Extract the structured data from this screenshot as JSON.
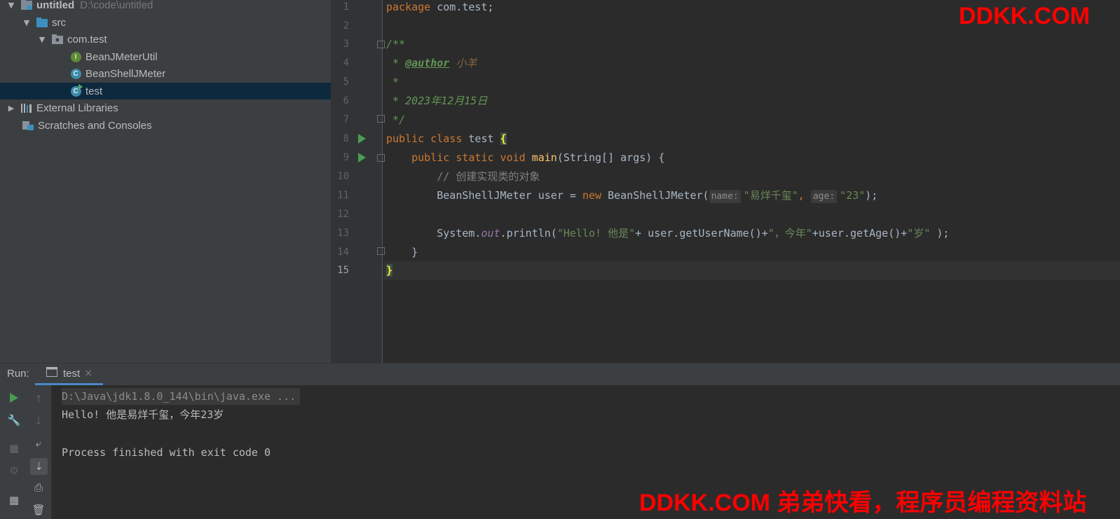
{
  "project_tree": {
    "root_name": "untitled",
    "root_path": "D:\\code\\untitled",
    "items": [
      {
        "label": "src"
      },
      {
        "label": "com.test"
      },
      {
        "label": "BeanJMeterUtil",
        "badge": "I"
      },
      {
        "label": "BeanShellJMeter",
        "badge": "C"
      },
      {
        "label": "test",
        "badge": "C"
      },
      {
        "label": "External Libraries"
      },
      {
        "label": "Scratches and Consoles"
      }
    ]
  },
  "editor": {
    "line_numbers": [
      "1",
      "2",
      "3",
      "4",
      "5",
      "6",
      "7",
      "8",
      "9",
      "10",
      "11",
      "12",
      "13",
      "14",
      "15"
    ],
    "current_line": "15",
    "code": {
      "l1_kw": "package",
      "l1_rest": " com.test;",
      "l3": "/**",
      "l4_star": " * ",
      "l4_tag": "@author",
      "l4_val": " 小羊",
      "l5": " *",
      "l6": " * 2023年12月15日",
      "l7": " */",
      "l8_kw": "public class",
      "l8_name": " test ",
      "l8_brace": "{",
      "l9_indent": "    ",
      "l9_kw": "public static void",
      "l9_fn": " main",
      "l9_rest": "(String[] args) {",
      "l10": "        // 创建实现类的对象",
      "l11_indent": "        ",
      "l11_a": "BeanShellJMeter user = ",
      "l11_kw": "new",
      "l11_b": " BeanShellJMeter(",
      "l11_hint1": "name:",
      "l11_s1": "\"易烊千玺\"",
      "l11_c": ", ",
      "l11_hint2": "age:",
      "l11_s2": "\"23\"",
      "l11_d": ");",
      "l13_indent": "        ",
      "l13_a": "System.",
      "l13_out": "out",
      "l13_b": ".println(",
      "l13_s1": "\"Hello! 他是\"",
      "l13_c": "+ user.getUserName()+",
      "l13_s2": "\"，今年\"",
      "l13_d": "+user.getAge()+",
      "l13_s3": "\"岁\"",
      "l13_e": " );",
      "l14": "    }",
      "l15": "}"
    }
  },
  "run_panel": {
    "label": "Run:",
    "tab": "test",
    "tab_close": "×",
    "console": {
      "cmd": "D:\\Java\\jdk1.8.0_144\\bin\\java.exe ...",
      "output": "Hello! 他是易烊千玺，今年23岁",
      "exit": "Process finished with exit code 0"
    }
  },
  "watermarks": {
    "top": "DDKK.COM",
    "bottom": "DDKK.COM 弟弟快看，程序员编程资料站"
  },
  "colors": {
    "keyword": "#cc7832",
    "string": "#6a8759",
    "doc_comment": "#629755",
    "function": "#ffc66d",
    "selection": "#0d293e",
    "watermark": "#ff0000"
  }
}
